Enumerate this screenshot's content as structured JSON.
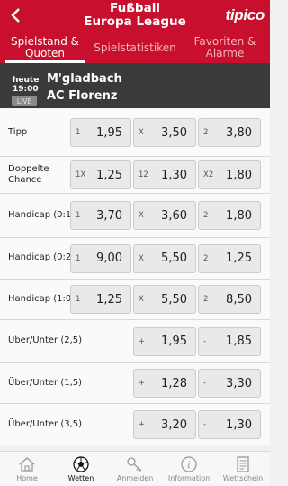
{
  "header": {
    "title_line1": "Fußball",
    "title_line2": "Europa League",
    "brand": "tipico"
  },
  "tabs": [
    {
      "line1": "Spielstand &",
      "line2": "Quoten",
      "active": true
    },
    {
      "line1": "Spielstatistiken",
      "line2": "",
      "active": false
    },
    {
      "line1": "Favoriten &",
      "line2": "Alarme",
      "active": false
    }
  ],
  "match": {
    "day": "heute",
    "time": "19:00",
    "live": "LIVE",
    "home": "M'gladbach",
    "away": "AC Florenz"
  },
  "bets": [
    {
      "label": "Tipp",
      "odds": [
        {
          "key": "1",
          "value": "1,95"
        },
        {
          "key": "X",
          "value": "3,50"
        },
        {
          "key": "2",
          "value": "3,80"
        }
      ]
    },
    {
      "label_line1": "Doppelte",
      "label_line2": "Chance",
      "odds": [
        {
          "key": "1X",
          "value": "1,25"
        },
        {
          "key": "12",
          "value": "1,30"
        },
        {
          "key": "X2",
          "value": "1,80"
        }
      ]
    },
    {
      "label": "Handicap (0:1)",
      "odds": [
        {
          "key": "1",
          "value": "3,70"
        },
        {
          "key": "X",
          "value": "3,60"
        },
        {
          "key": "2",
          "value": "1,80"
        }
      ]
    },
    {
      "label": "Handicap (0:2)",
      "odds": [
        {
          "key": "1",
          "value": "9,00"
        },
        {
          "key": "X",
          "value": "5,50"
        },
        {
          "key": "2",
          "value": "1,25"
        }
      ]
    },
    {
      "label": "Handicap (1:0)",
      "odds": [
        {
          "key": "1",
          "value": "1,25"
        },
        {
          "key": "X",
          "value": "5,50"
        },
        {
          "key": "2",
          "value": "8,50"
        }
      ]
    },
    {
      "label": "Über/Unter (2,5)",
      "odds": [
        {
          "key": "+",
          "value": "1,95"
        },
        {
          "key": "-",
          "value": "1,85"
        }
      ]
    },
    {
      "label": "Über/Unter (1,5)",
      "odds": [
        {
          "key": "+",
          "value": "1,28"
        },
        {
          "key": "-",
          "value": "3,30"
        }
      ]
    },
    {
      "label": "Über/Unter (3,5)",
      "odds": [
        {
          "key": "+",
          "value": "3,20"
        },
        {
          "key": "-",
          "value": "1,30"
        }
      ]
    }
  ],
  "nav": [
    {
      "label": "Home",
      "icon": "home-icon"
    },
    {
      "label": "Wetten",
      "icon": "football-icon",
      "active": true
    },
    {
      "label": "Anmelden",
      "icon": "key-icon"
    },
    {
      "label": "Information",
      "icon": "info-icon"
    },
    {
      "label": "Wettschein",
      "icon": "betslip-icon"
    }
  ],
  "colors": {
    "brand_red": "#c8102e",
    "match_bg": "#3a3a3a"
  }
}
